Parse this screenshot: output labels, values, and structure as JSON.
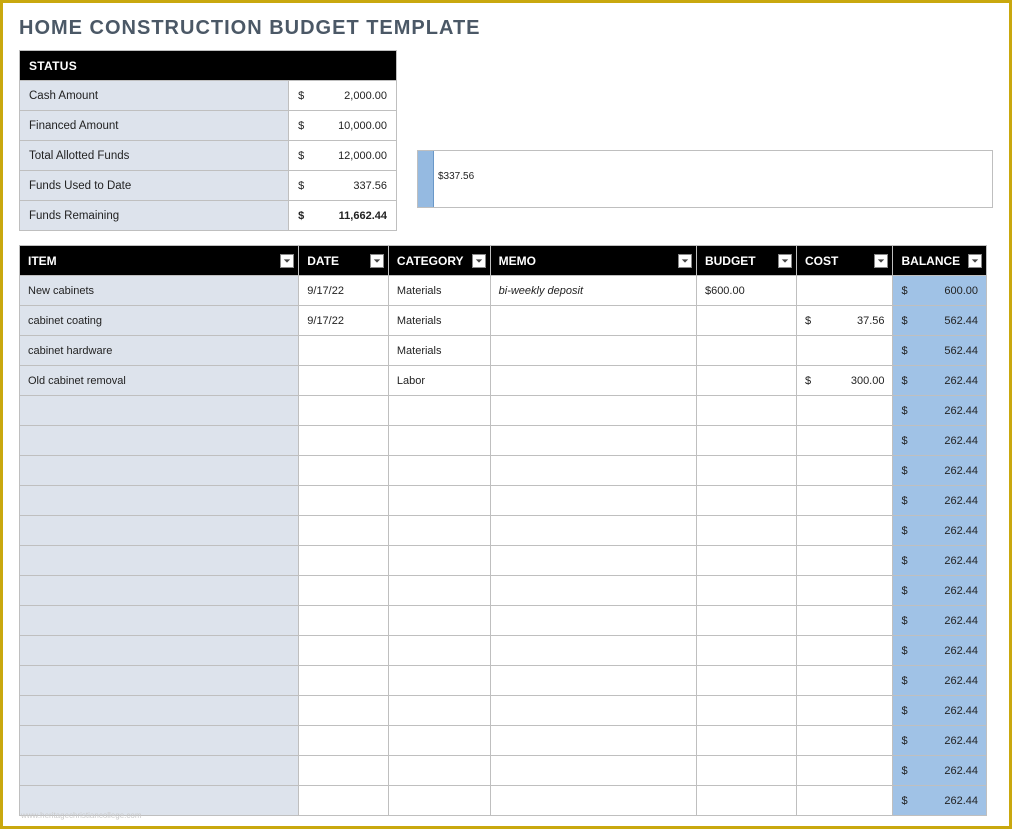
{
  "title": "HOME CONSTRUCTION BUDGET TEMPLATE",
  "status": {
    "header": "STATUS",
    "rows": [
      {
        "label": "Cash Amount",
        "cur": "$",
        "amt": "2,000.00",
        "bold": false
      },
      {
        "label": "Financed Amount",
        "cur": "$",
        "amt": "10,000.00",
        "bold": false
      },
      {
        "label": "Total Allotted Funds",
        "cur": "$",
        "amt": "12,000.00",
        "bold": false
      },
      {
        "label": "Funds Used to Date",
        "cur": "$",
        "amt": "337.56",
        "bold": false
      },
      {
        "label": "Funds Remaining",
        "cur": "$",
        "amt": "11,662.44",
        "bold": true
      }
    ]
  },
  "progress": {
    "label": "$337.56",
    "widthPx": 16,
    "labelLeftPx": 20,
    "labelTopPx": 20
  },
  "columns": {
    "item": "ITEM",
    "date": "DATE",
    "category": "CATEGORY",
    "memo": "MEMO",
    "budget": "BUDGET",
    "cost": "COST",
    "balance": "BALANCE"
  },
  "rows": [
    {
      "item": "New cabinets",
      "date": "9/17/22",
      "category": "Materials",
      "memo": "bi-weekly deposit",
      "budget": "$600.00",
      "costCur": "",
      "cost": "",
      "balCur": "$",
      "bal": "600.00"
    },
    {
      "item": "cabinet coating",
      "date": "9/17/22",
      "category": "Materials",
      "memo": "",
      "budget": "",
      "costCur": "$",
      "cost": "37.56",
      "balCur": "$",
      "bal": "562.44"
    },
    {
      "item": "cabinet hardware",
      "date": "",
      "category": "Materials",
      "memo": "",
      "budget": "",
      "costCur": "",
      "cost": "",
      "balCur": "$",
      "bal": "562.44"
    },
    {
      "item": "Old cabinet removal",
      "date": "",
      "category": "Labor",
      "memo": "",
      "budget": "",
      "costCur": "$",
      "cost": "300.00",
      "balCur": "$",
      "bal": "262.44"
    },
    {
      "item": "",
      "date": "",
      "category": "",
      "memo": "",
      "budget": "",
      "costCur": "",
      "cost": "",
      "balCur": "$",
      "bal": "262.44"
    },
    {
      "item": "",
      "date": "",
      "category": "",
      "memo": "",
      "budget": "",
      "costCur": "",
      "cost": "",
      "balCur": "$",
      "bal": "262.44"
    },
    {
      "item": "",
      "date": "",
      "category": "",
      "memo": "",
      "budget": "",
      "costCur": "",
      "cost": "",
      "balCur": "$",
      "bal": "262.44"
    },
    {
      "item": "",
      "date": "",
      "category": "",
      "memo": "",
      "budget": "",
      "costCur": "",
      "cost": "",
      "balCur": "$",
      "bal": "262.44"
    },
    {
      "item": "",
      "date": "",
      "category": "",
      "memo": "",
      "budget": "",
      "costCur": "",
      "cost": "",
      "balCur": "$",
      "bal": "262.44"
    },
    {
      "item": "",
      "date": "",
      "category": "",
      "memo": "",
      "budget": "",
      "costCur": "",
      "cost": "",
      "balCur": "$",
      "bal": "262.44"
    },
    {
      "item": "",
      "date": "",
      "category": "",
      "memo": "",
      "budget": "",
      "costCur": "",
      "cost": "",
      "balCur": "$",
      "bal": "262.44"
    },
    {
      "item": "",
      "date": "",
      "category": "",
      "memo": "",
      "budget": "",
      "costCur": "",
      "cost": "",
      "balCur": "$",
      "bal": "262.44"
    },
    {
      "item": "",
      "date": "",
      "category": "",
      "memo": "",
      "budget": "",
      "costCur": "",
      "cost": "",
      "balCur": "$",
      "bal": "262.44"
    },
    {
      "item": "",
      "date": "",
      "category": "",
      "memo": "",
      "budget": "",
      "costCur": "",
      "cost": "",
      "balCur": "$",
      "bal": "262.44"
    },
    {
      "item": "",
      "date": "",
      "category": "",
      "memo": "",
      "budget": "",
      "costCur": "",
      "cost": "",
      "balCur": "$",
      "bal": "262.44"
    },
    {
      "item": "",
      "date": "",
      "category": "",
      "memo": "",
      "budget": "",
      "costCur": "",
      "cost": "",
      "balCur": "$",
      "bal": "262.44"
    },
    {
      "item": "",
      "date": "",
      "category": "",
      "memo": "",
      "budget": "",
      "costCur": "",
      "cost": "",
      "balCur": "$",
      "bal": "262.44"
    },
    {
      "item": "",
      "date": "",
      "category": "",
      "memo": "",
      "budget": "",
      "costCur": "",
      "cost": "",
      "balCur": "$",
      "bal": "262.44"
    }
  ],
  "watermark": "www.heritagechristiancollege.com"
}
